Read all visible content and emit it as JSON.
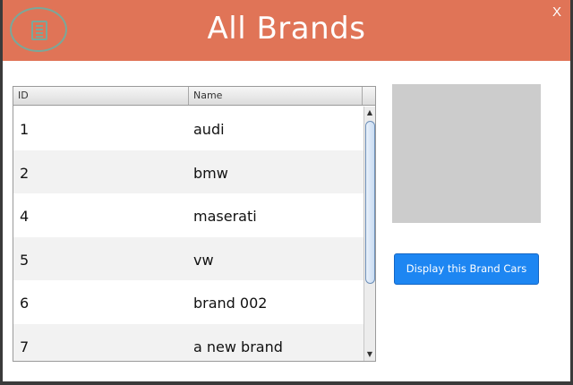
{
  "window": {
    "title": "All Brands",
    "close_label": "X",
    "header_color": "#e07457"
  },
  "table": {
    "columns": [
      "ID",
      "Name"
    ],
    "rows": [
      {
        "id": "1",
        "name": "audi"
      },
      {
        "id": "2",
        "name": "bmw"
      },
      {
        "id": "4",
        "name": "maserati"
      },
      {
        "id": "5",
        "name": "vw"
      },
      {
        "id": "6",
        "name": "brand 002"
      },
      {
        "id": "7",
        "name": "a new brand"
      }
    ]
  },
  "icons": {
    "logo": "document-icon",
    "scroll_up": "scroll-up-arrow-icon",
    "scroll_down": "scroll-down-arrow-icon"
  },
  "actions": {
    "display_label": "Display this Brand Cars",
    "button_color": "#1d86f2"
  }
}
